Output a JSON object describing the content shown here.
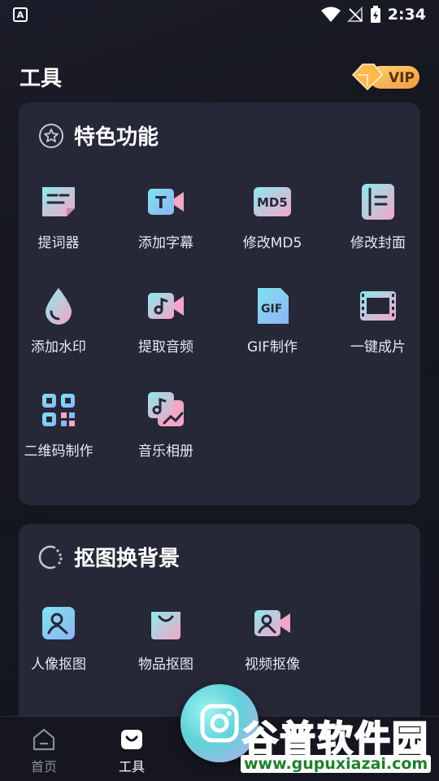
{
  "status_bar": {
    "app_icon_letter": "A",
    "time": "2:34"
  },
  "header": {
    "title": "工具",
    "vip_label": "VIP"
  },
  "featured": {
    "title": "特色功能",
    "tools": [
      {
        "label": "提词器",
        "icon": "teleprompter-icon"
      },
      {
        "label": "添加字幕",
        "icon": "subtitle-icon"
      },
      {
        "label": "修改MD5",
        "icon": "md5-icon"
      },
      {
        "label": "修改封面",
        "icon": "cover-icon"
      },
      {
        "label": "添加水印",
        "icon": "watermark-icon"
      },
      {
        "label": "提取音频",
        "icon": "extract-audio-icon"
      },
      {
        "label": "GIF制作",
        "icon": "gif-icon"
      },
      {
        "label": "一键成片",
        "icon": "film-icon"
      },
      {
        "label": "二维码制作",
        "icon": "qrcode-icon"
      },
      {
        "label": "音乐相册",
        "icon": "music-album-icon"
      }
    ]
  },
  "cutout": {
    "title": "抠图换背景",
    "tools": [
      {
        "label": "人像抠图",
        "icon": "portrait-cutout-icon"
      },
      {
        "label": "物品抠图",
        "icon": "object-cutout-icon"
      },
      {
        "label": "视频抠像",
        "icon": "video-cutout-icon"
      }
    ]
  },
  "bottom_nav": {
    "items": [
      {
        "label": "首页",
        "icon": "home-icon",
        "active": false
      },
      {
        "label": "工具",
        "icon": "tools-icon",
        "active": true
      }
    ]
  },
  "watermark": {
    "title": "谷普软件园",
    "url": "www.gupuxiazai.com"
  },
  "colors": {
    "background": "#15161f",
    "card": "#262838",
    "accent_cyan": "#5fd3d8",
    "accent_pink": "#f0a9c8",
    "vip_gold": "#f4b04a",
    "watermark_green": "#2f9c3b"
  }
}
